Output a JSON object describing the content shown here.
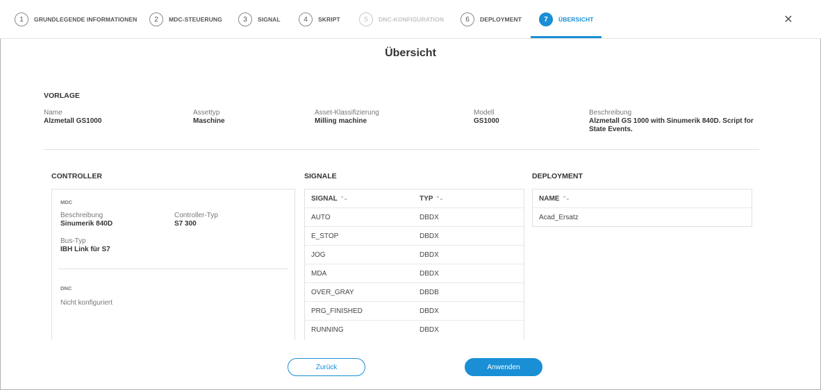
{
  "steps": [
    {
      "num": "1",
      "label": "GRUNDLEGENDE INFORMATIONEN",
      "state": "done"
    },
    {
      "num": "2",
      "label": "MDC-STEUERUNG",
      "state": "done"
    },
    {
      "num": "3",
      "label": "SIGNAL",
      "state": "done"
    },
    {
      "num": "4",
      "label": "SKRIPT",
      "state": "done"
    },
    {
      "num": "5",
      "label": "DNC-KONFIGURATION",
      "state": "disabled"
    },
    {
      "num": "6",
      "label": "DEPLOYMENT",
      "state": "done"
    },
    {
      "num": "7",
      "label": "ÜBERSICHT",
      "state": "active"
    }
  ],
  "close_icon": "close-icon",
  "page_title": "Übersicht",
  "vorlage": {
    "heading": "VORLAGE",
    "fields": [
      {
        "label": "Name",
        "value": "Alzmetall GS1000"
      },
      {
        "label": "Assettyp",
        "value": "Maschine"
      },
      {
        "label": "Asset-Klassifizierung",
        "value": "Milling machine"
      },
      {
        "label": "Modell",
        "value": "GS1000"
      },
      {
        "label": "Beschreibung",
        "value": "Alzmetall GS 1000 with Sinumerik 840D. Script for State Events."
      }
    ]
  },
  "controller": {
    "heading": "CONTROLLER",
    "mdc": {
      "title": "MDC",
      "beschreibung_label": "Beschreibung",
      "beschreibung_value": "Sinumerik 840D",
      "controller_typ_label": "Controller-Typ",
      "controller_typ_value": "S7 300",
      "bus_typ_label": "Bus-Typ",
      "bus_typ_value": "IBH Link für S7"
    },
    "dnc": {
      "title": "DNC",
      "status": "Nicht konfiguriert"
    }
  },
  "signale": {
    "heading": "SIGNALE",
    "columns": [
      "SIGNAL",
      "TYP"
    ],
    "rows": [
      [
        "AUTO",
        "DBDX"
      ],
      [
        "E_STOP",
        "DBDX"
      ],
      [
        "JOG",
        "DBDX"
      ],
      [
        "MDA",
        "DBDX"
      ],
      [
        "OVER_GRAY",
        "DBDB"
      ],
      [
        "PRG_FINISHED",
        "DBDX"
      ],
      [
        "RUNNING",
        "DBDX"
      ]
    ]
  },
  "deployment": {
    "heading": "DEPLOYMENT",
    "columns": [
      "NAME"
    ],
    "rows": [
      [
        "Acad_Ersatz"
      ]
    ]
  },
  "buttons": {
    "back": "Zurück",
    "apply": "Anwenden"
  },
  "colors": {
    "accent": "#1a8fd6"
  }
}
